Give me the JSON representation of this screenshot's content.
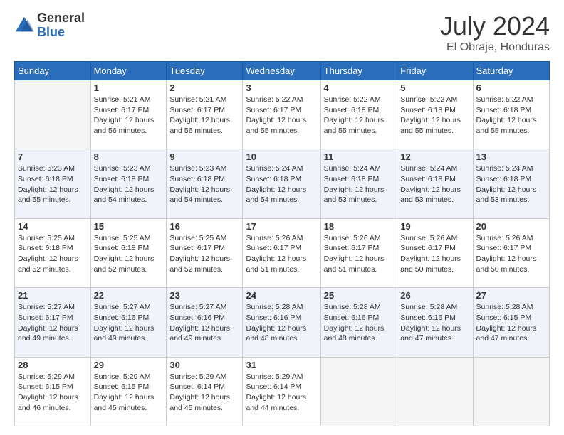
{
  "logo": {
    "general": "General",
    "blue": "Blue"
  },
  "title": "July 2024",
  "location": "El Obraje, Honduras",
  "days_header": [
    "Sunday",
    "Monday",
    "Tuesday",
    "Wednesday",
    "Thursday",
    "Friday",
    "Saturday"
  ],
  "weeks": [
    [
      {
        "day": "",
        "info": ""
      },
      {
        "day": "1",
        "info": "Sunrise: 5:21 AM\nSunset: 6:17 PM\nDaylight: 12 hours\nand 56 minutes."
      },
      {
        "day": "2",
        "info": "Sunrise: 5:21 AM\nSunset: 6:17 PM\nDaylight: 12 hours\nand 56 minutes."
      },
      {
        "day": "3",
        "info": "Sunrise: 5:22 AM\nSunset: 6:17 PM\nDaylight: 12 hours\nand 55 minutes."
      },
      {
        "day": "4",
        "info": "Sunrise: 5:22 AM\nSunset: 6:18 PM\nDaylight: 12 hours\nand 55 minutes."
      },
      {
        "day": "5",
        "info": "Sunrise: 5:22 AM\nSunset: 6:18 PM\nDaylight: 12 hours\nand 55 minutes."
      },
      {
        "day": "6",
        "info": "Sunrise: 5:22 AM\nSunset: 6:18 PM\nDaylight: 12 hours\nand 55 minutes."
      }
    ],
    [
      {
        "day": "7",
        "info": ""
      },
      {
        "day": "8",
        "info": "Sunrise: 5:23 AM\nSunset: 6:18 PM\nDaylight: 12 hours\nand 54 minutes."
      },
      {
        "day": "9",
        "info": "Sunrise: 5:23 AM\nSunset: 6:18 PM\nDaylight: 12 hours\nand 54 minutes."
      },
      {
        "day": "10",
        "info": "Sunrise: 5:24 AM\nSunset: 6:18 PM\nDaylight: 12 hours\nand 54 minutes."
      },
      {
        "day": "11",
        "info": "Sunrise: 5:24 AM\nSunset: 6:18 PM\nDaylight: 12 hours\nand 53 minutes."
      },
      {
        "day": "12",
        "info": "Sunrise: 5:24 AM\nSunset: 6:18 PM\nDaylight: 12 hours\nand 53 minutes."
      },
      {
        "day": "13",
        "info": "Sunrise: 5:24 AM\nSunset: 6:18 PM\nDaylight: 12 hours\nand 53 minutes."
      }
    ],
    [
      {
        "day": "14",
        "info": ""
      },
      {
        "day": "15",
        "info": "Sunrise: 5:25 AM\nSunset: 6:18 PM\nDaylight: 12 hours\nand 52 minutes."
      },
      {
        "day": "16",
        "info": "Sunrise: 5:25 AM\nSunset: 6:17 PM\nDaylight: 12 hours\nand 52 minutes."
      },
      {
        "day": "17",
        "info": "Sunrise: 5:26 AM\nSunset: 6:17 PM\nDaylight: 12 hours\nand 51 minutes."
      },
      {
        "day": "18",
        "info": "Sunrise: 5:26 AM\nSunset: 6:17 PM\nDaylight: 12 hours\nand 51 minutes."
      },
      {
        "day": "19",
        "info": "Sunrise: 5:26 AM\nSunset: 6:17 PM\nDaylight: 12 hours\nand 50 minutes."
      },
      {
        "day": "20",
        "info": "Sunrise: 5:26 AM\nSunset: 6:17 PM\nDaylight: 12 hours\nand 50 minutes."
      }
    ],
    [
      {
        "day": "21",
        "info": ""
      },
      {
        "day": "22",
        "info": "Sunrise: 5:27 AM\nSunset: 6:16 PM\nDaylight: 12 hours\nand 49 minutes."
      },
      {
        "day": "23",
        "info": "Sunrise: 5:27 AM\nSunset: 6:16 PM\nDaylight: 12 hours\nand 49 minutes."
      },
      {
        "day": "24",
        "info": "Sunrise: 5:28 AM\nSunset: 6:16 PM\nDaylight: 12 hours\nand 48 minutes."
      },
      {
        "day": "25",
        "info": "Sunrise: 5:28 AM\nSunset: 6:16 PM\nDaylight: 12 hours\nand 48 minutes."
      },
      {
        "day": "26",
        "info": "Sunrise: 5:28 AM\nSunset: 6:16 PM\nDaylight: 12 hours\nand 47 minutes."
      },
      {
        "day": "27",
        "info": "Sunrise: 5:28 AM\nSunset: 6:15 PM\nDaylight: 12 hours\nand 47 minutes."
      }
    ],
    [
      {
        "day": "28",
        "info": "Sunrise: 5:29 AM\nSunset: 6:15 PM\nDaylight: 12 hours\nand 46 minutes."
      },
      {
        "day": "29",
        "info": "Sunrise: 5:29 AM\nSunset: 6:15 PM\nDaylight: 12 hours\nand 45 minutes."
      },
      {
        "day": "30",
        "info": "Sunrise: 5:29 AM\nSunset: 6:14 PM\nDaylight: 12 hours\nand 45 minutes."
      },
      {
        "day": "31",
        "info": "Sunrise: 5:29 AM\nSunset: 6:14 PM\nDaylight: 12 hours\nand 44 minutes."
      },
      {
        "day": "",
        "info": ""
      },
      {
        "day": "",
        "info": ""
      },
      {
        "day": "",
        "info": ""
      }
    ]
  ],
  "week1_sunday_info": "Sunrise: 5:23 AM\nSunset: 6:18 PM\nDaylight: 12 hours\nand 55 minutes.",
  "week3_sunday_info": "Sunrise: 5:25 AM\nSunset: 6:18 PM\nDaylight: 12 hours\nand 52 minutes.",
  "week4_sunday_info": "Sunrise: 5:27 AM\nSunset: 6:17 PM\nDaylight: 12 hours\nand 49 minutes."
}
